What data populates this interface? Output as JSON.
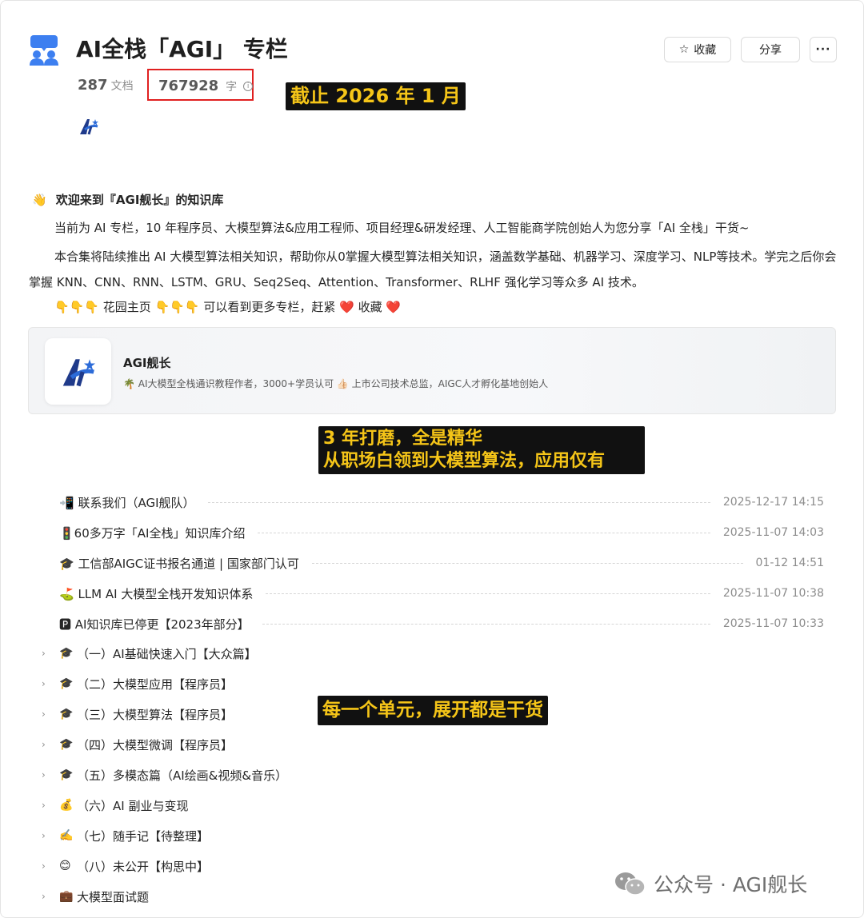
{
  "header": {
    "title": "AI全栈「AGI」 专栏",
    "favorite_label": "收藏",
    "share_label": "分享",
    "more_label": "···",
    "doc_count": "287",
    "doc_unit": "文档",
    "word_count": "767928",
    "word_unit": "字"
  },
  "callouts": {
    "date": "截止 2026 年 1 月",
    "years_line1": "3 年打磨，全是精华",
    "years_line2": "从职场白领到大模型算法，应用仅有",
    "units": "每一个单元，展开都是干货"
  },
  "intro": {
    "welcome_emoji": "👋",
    "welcome": "欢迎来到『AGI舰长』的知识库",
    "p1": "当前为 AI 专栏，10 年程序员、大模型算法&应用工程师、项目经理&研发经理、人工智能商学院创始人为您分享「AI 全栈」干货~",
    "p2": "本合集将陆续推出 AI 大模型算法相关知识，帮助你从0掌握大模型算法相关知识，涵盖数学基础、机器学习、深度学习、NLP等技术。学完之后你会掌握 KNN、CNN、RNN、LSTM、GRU、Seq2Seq、Attention、Transformer、RLHF 强化学习等众多 AI 技术。",
    "p3": "👇👇👇 花园主页 👇👇👇 可以看到更多专栏，赶紧 ❤️ 收藏 ❤️"
  },
  "card": {
    "name": "AGI舰长",
    "desc": "🌴 AI大模型全栈通识教程作者，3000+学员认可 👍🏻 上市公司技术总监，AIGC人才孵化基地创始人"
  },
  "docs": [
    {
      "title": "📲 联系我们（AGI舰队）",
      "date": "2025-12-17 14:15"
    },
    {
      "title": "🚦60多万字「AI全栈」知识库介绍",
      "date": "2025-11-07 14:03"
    },
    {
      "title": "🎓 工信部AIGC证书报名通道 | 国家部门认可",
      "date": "01-12 14:51"
    },
    {
      "title": "⛳ LLM AI 大模型全栈开发知识体系",
      "date": "2025-11-07 10:38"
    },
    {
      "title": "🅿 AI知识库已停更【2023年部分】",
      "date": "2025-11-07 10:33"
    }
  ],
  "folders": [
    {
      "emoji": "🎓",
      "title": "（一）AI基础快速入门【大众篇】"
    },
    {
      "emoji": "🎓",
      "title": "（二）大模型应用【程序员】"
    },
    {
      "emoji": "🎓",
      "title": "（三）大模型算法【程序员】"
    },
    {
      "emoji": "🎓",
      "title": "（四）大模型微调【程序员】"
    },
    {
      "emoji": "🎓",
      "title": "（五）多模态篇（AI绘画&视频&音乐）"
    },
    {
      "emoji": "💰",
      "title": "（六）AI 副业与变现"
    },
    {
      "emoji": "✍️",
      "title": "（七）随手记【待整理】"
    },
    {
      "emoji": "😊",
      "title": "（八）未公开【构思中】"
    },
    {
      "emoji": "💼",
      "title": "大模型面试题"
    }
  ],
  "watermark": "公众号 · AGI舰长",
  "colors": {
    "highlight_box": "#e02020",
    "callout_bg": "#111111",
    "callout_text": "#f5c518",
    "logo_blue": "#1f3a8a"
  }
}
